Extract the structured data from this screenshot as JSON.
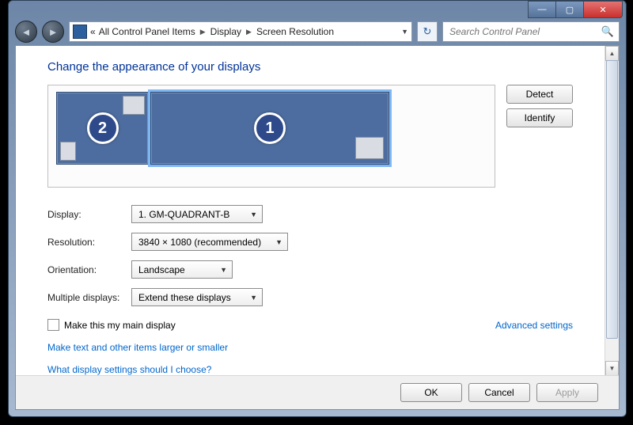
{
  "breadcrumbs": {
    "root": "All Control Panel Items",
    "mid": "Display",
    "leaf": "Screen Resolution",
    "chevron": "«"
  },
  "search": {
    "placeholder": "Search Control Panel"
  },
  "heading": "Change the appearance of your displays",
  "buttons": {
    "detect": "Detect",
    "identify": "Identify",
    "ok": "OK",
    "cancel": "Cancel",
    "apply": "Apply"
  },
  "monitors": {
    "primary": "1",
    "secondary": "2"
  },
  "labels": {
    "display": "Display:",
    "resolution": "Resolution:",
    "orientation": "Orientation:",
    "multiple": "Multiple displays:",
    "mainchk": "Make this my main display",
    "advanced": "Advanced settings"
  },
  "values": {
    "display": "1. GM-QUADRANT-B",
    "resolution": "3840 × 1080 (recommended)",
    "orientation": "Landscape",
    "multiple": "Extend these displays"
  },
  "links": {
    "textsize": "Make text and other items larger or smaller",
    "help": "What display settings should I choose?"
  }
}
